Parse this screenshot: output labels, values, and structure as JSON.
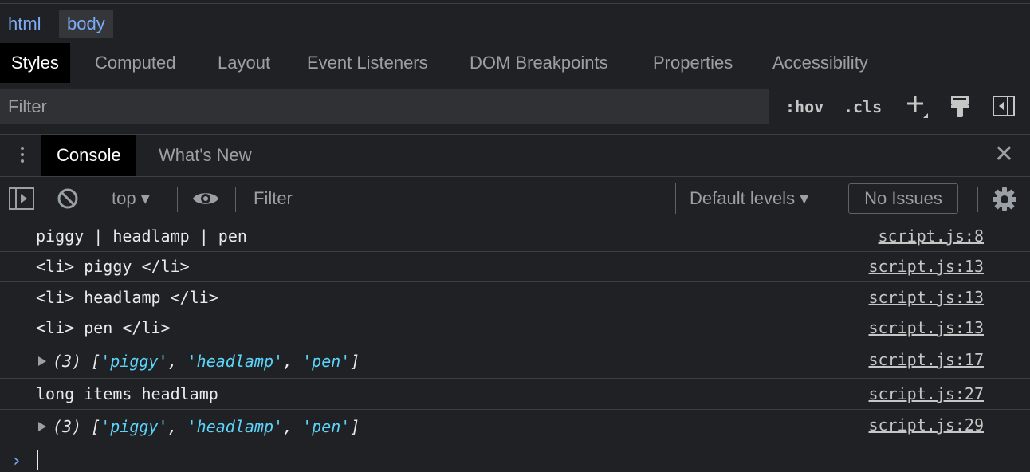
{
  "breadcrumb": [
    "html",
    "body"
  ],
  "styles_tabs": [
    "Styles",
    "Computed",
    "Layout",
    "Event Listeners",
    "DOM Breakpoints",
    "Properties",
    "Accessibility"
  ],
  "styles_toolbar": {
    "filter_placeholder": "Filter",
    "hov": ":hov",
    "cls": ".cls",
    "icons": [
      "plus-icon",
      "paint-brush-icon",
      "toggle-sidebar-icon"
    ]
  },
  "drawer": {
    "tabs": [
      "Console",
      "What's New"
    ],
    "icons": [
      "kebab-menu-icon",
      "close-icon"
    ]
  },
  "console_toolbar": {
    "context": "top",
    "filter_placeholder": "Filter",
    "levels": "Default levels",
    "issues": "No Issues",
    "icons": [
      "sidebar-toggle-icon",
      "clear-icon",
      "eye-icon",
      "gear-icon"
    ]
  },
  "messages": [
    {
      "text": "piggy | headlamp | pen",
      "source": "script.js:8"
    },
    {
      "text": "<li> piggy </li>",
      "source": "script.js:13"
    },
    {
      "text": "<li> headlamp </li>",
      "source": "script.js:13"
    },
    {
      "text": "<li> pen </li>",
      "source": "script.js:13"
    },
    {
      "array": {
        "count": "(3)",
        "items": [
          "'piggy'",
          "'headlamp'",
          "'pen'"
        ]
      },
      "source": "script.js:17"
    },
    {
      "text": "long items headlamp",
      "source": "script.js:27"
    },
    {
      "array": {
        "count": "(3)",
        "items": [
          "'piggy'",
          "'headlamp'",
          "'pen'"
        ]
      },
      "source": "script.js:29"
    }
  ],
  "prompt_symbol": "›",
  "colors": {
    "background": "#202124",
    "link": "#7cacf8",
    "string": "#5cd5fb"
  }
}
